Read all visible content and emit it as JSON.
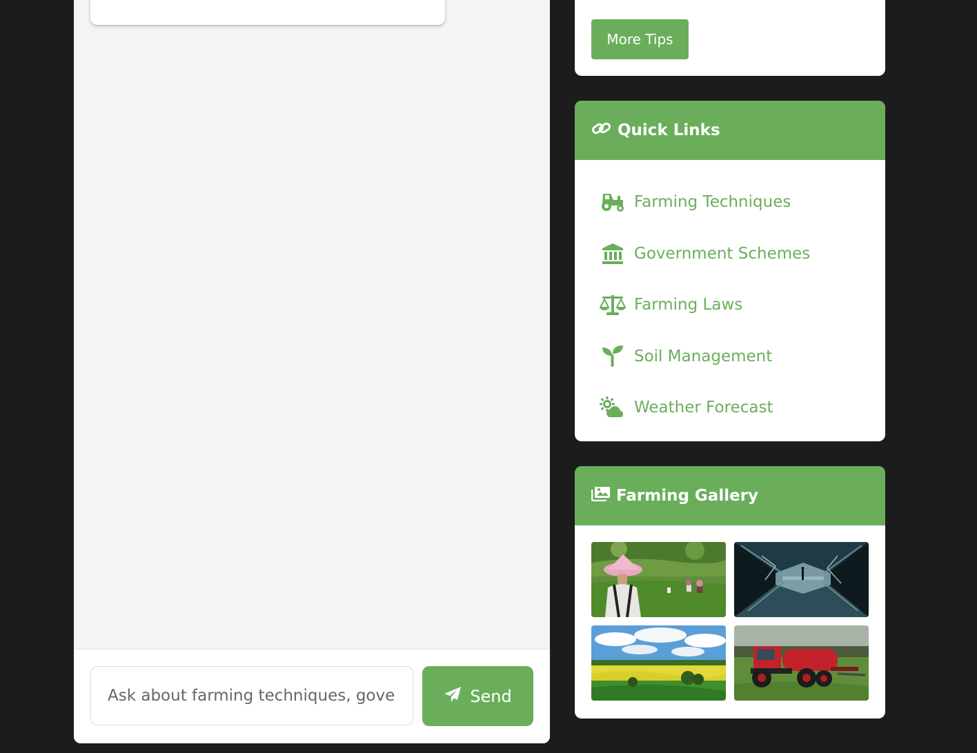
{
  "chat": {
    "input_placeholder": "Ask about farming techniques, government schemes, or farming laws...",
    "send_label": "Send"
  },
  "tips": {
    "more_label": "More Tips"
  },
  "quick_links": {
    "title": "Quick Links",
    "items": [
      {
        "label": "Farming Techniques",
        "icon": "tractor-icon"
      },
      {
        "label": "Government Schemes",
        "icon": "landmark-icon"
      },
      {
        "label": "Farming Laws",
        "icon": "scale-icon"
      },
      {
        "label": "Soil Management",
        "icon": "seedling-icon"
      },
      {
        "label": "Weather Forecast",
        "icon": "cloud-sun-icon"
      }
    ]
  },
  "gallery": {
    "title": "Farming Gallery",
    "images": [
      {
        "subject": "farmer-in-field"
      },
      {
        "subject": "reflective-tunnel"
      },
      {
        "subject": "rapeseed-field-landscape"
      },
      {
        "subject": "red-tractor-tanker"
      }
    ]
  },
  "colors": {
    "accent": "#6aae5c",
    "page_background": "#1c1c1c",
    "panel_background": "#f4f4f4",
    "card_background": "#ffffff"
  }
}
